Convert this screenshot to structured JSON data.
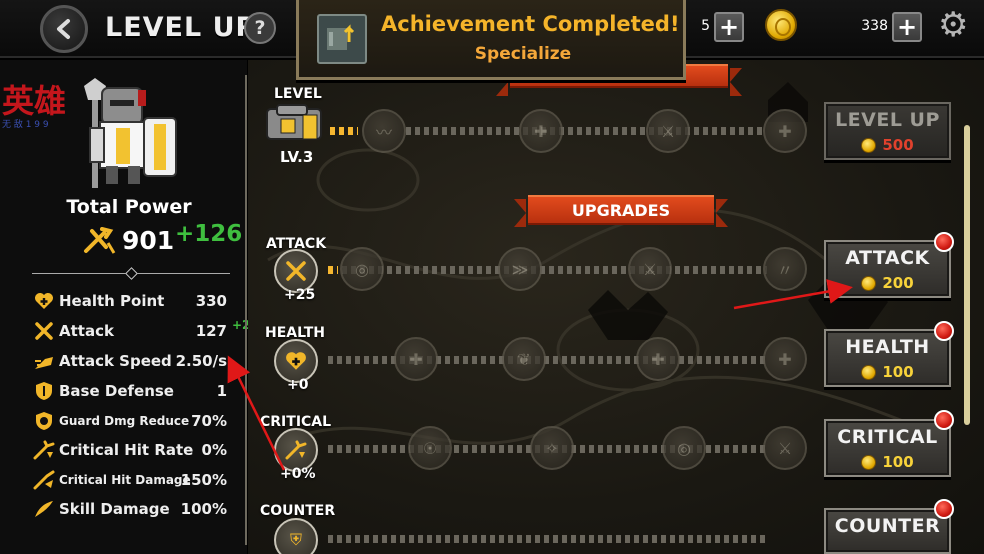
{
  "header": {
    "title": "LEVEL UP",
    "help_label": "?",
    "gems": "5",
    "gold": "338",
    "plus_label": "+"
  },
  "toast": {
    "title": "Achievement Completed!",
    "subtitle": "Specialize"
  },
  "hero": {
    "watermark": "英雄",
    "watermark_sub": "无 敌 1 9 9",
    "total_power_label": "Total Power",
    "total_power": "901",
    "power_bonus": "+126",
    "level_label": "LEVEL",
    "level_value": "LV.3"
  },
  "stats": [
    {
      "label": "Health Point",
      "value": "330",
      "icon": "heart-plus-icon"
    },
    {
      "label": "Attack",
      "value": "127",
      "icon": "crossed-swords-icon",
      "bonus": "+28"
    },
    {
      "label": "Attack Speed",
      "value": "2.50/s",
      "icon": "speed-icon"
    },
    {
      "label": "Base Defense",
      "value": "1",
      "icon": "shield-icon"
    },
    {
      "label": "Guard Dmg Reduce",
      "value": "70%",
      "icon": "guard-shield-icon"
    },
    {
      "label": "Critical Hit Rate",
      "value": "0%",
      "icon": "crit-icon"
    },
    {
      "label": "Critical Hit Damage",
      "value": "150%",
      "icon": "crit-damage-icon"
    },
    {
      "label": "Skill Damage",
      "value": "100%",
      "icon": "skill-icon"
    }
  ],
  "upgrades_banner": "UPGRADES",
  "rows": {
    "attack": {
      "label": "ATTACK",
      "delta": "+25"
    },
    "health": {
      "label": "HEALTH",
      "delta": "+0"
    },
    "critical": {
      "label": "CRITICAL",
      "delta": "+0%"
    },
    "counter": {
      "label": "COUNTER"
    }
  },
  "buttons": {
    "level_up": {
      "label": "LEVEL UP",
      "cost": "500"
    },
    "attack": {
      "label": "ATTACK",
      "cost": "200"
    },
    "health": {
      "label": "HEALTH",
      "cost": "100"
    },
    "critical": {
      "label": "CRITICAL",
      "cost": "100"
    },
    "counter": {
      "label": "COUNTER"
    }
  },
  "colors": {
    "accent_gold": "#f6b730",
    "banner_red": "#d23c16",
    "bonus_green": "#3fbf3f",
    "toast_text": "#f5b42a",
    "annotation_arrow": "#e01818"
  }
}
